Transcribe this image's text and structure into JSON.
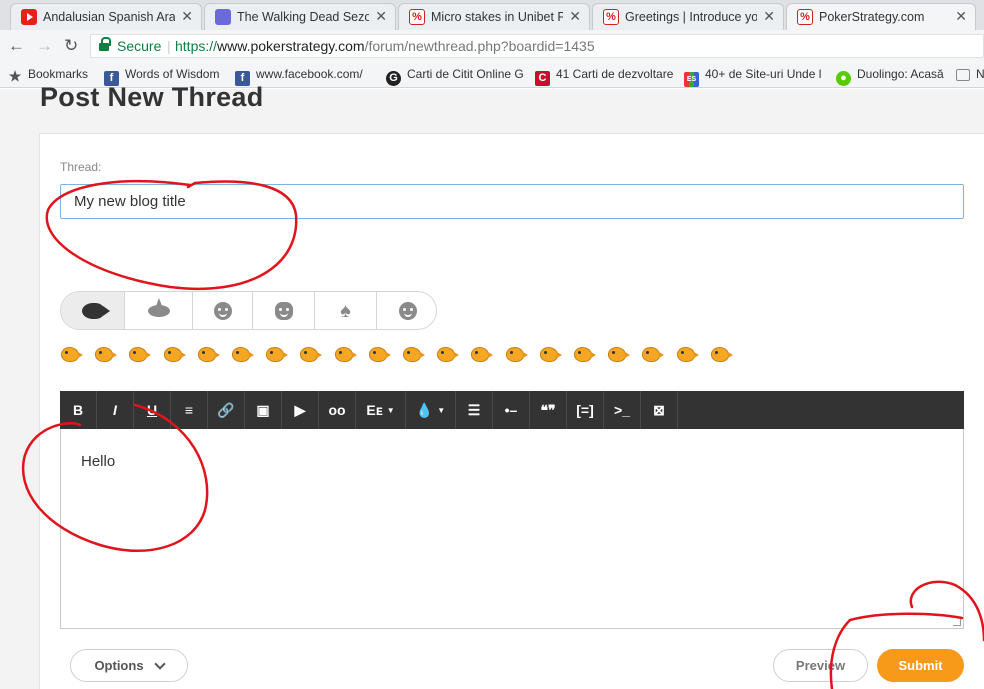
{
  "tabs": [
    {
      "title": "Andalusian Spanish Arab",
      "favicon": "youtube-icon",
      "active": false
    },
    {
      "title": "The Walking Dead Sezon",
      "favicon": "clapperboard-icon",
      "active": false
    },
    {
      "title": "Micro stakes in Unibet Po",
      "favicon": "pokerstrategy-icon",
      "active": false
    },
    {
      "title": "Greetings | Introduce you",
      "favicon": "pokerstrategy-icon",
      "active": false
    },
    {
      "title": "PokerStrategy.com",
      "favicon": "pokerstrategy-icon",
      "active": true
    }
  ],
  "address": {
    "secure_label": "Secure",
    "scheme": "https://",
    "host": "www.pokerstrategy.com",
    "path": "/forum/newthread.php?boardid=1435"
  },
  "bookmarks": [
    {
      "label": "Bookmarks",
      "icon": "star-icon"
    },
    {
      "label": "Words of Wisdom",
      "icon": "facebook-icon"
    },
    {
      "label": "www.facebook.com/",
      "icon": "facebook-icon"
    },
    {
      "label": "Carti de Citit Online G",
      "icon": "g-icon"
    },
    {
      "label": "41 Carti de dezvoltare",
      "icon": "c-icon"
    },
    {
      "label": "40+ de Site-uri Unde l",
      "icon": "site-icon"
    },
    {
      "label": "Duolingo: Acasă",
      "icon": "owl-icon"
    },
    {
      "label": "N",
      "icon": "book-icon"
    }
  ],
  "page": {
    "title": "Post New Thread",
    "thread_label": "Thread:",
    "thread_value": "My new blog title",
    "editor_text": "Hello"
  },
  "emoji_tabs": [
    "fish-icon",
    "shark-icon",
    "smiley-icon",
    "grin-icon",
    "spade-icon",
    "wink-icon"
  ],
  "smiley_count": 20,
  "toolbar": [
    {
      "name": "bold",
      "label": "B"
    },
    {
      "name": "italic",
      "label": "I"
    },
    {
      "name": "underline",
      "label": "U"
    },
    {
      "name": "align-center",
      "label": "≡"
    },
    {
      "name": "link",
      "label": "🔗"
    },
    {
      "name": "image",
      "label": "▣"
    },
    {
      "name": "video",
      "label": "▶"
    },
    {
      "name": "voicemail",
      "label": "oo"
    },
    {
      "name": "font-size",
      "label": "Eᴇ"
    },
    {
      "name": "color",
      "label": "💧"
    },
    {
      "name": "bullet-list",
      "label": "☰"
    },
    {
      "name": "horizontal-rule",
      "label": "•–"
    },
    {
      "name": "quote",
      "label": "❝❞"
    },
    {
      "name": "code-block",
      "label": "[=]"
    },
    {
      "name": "terminal",
      "label": ">_"
    },
    {
      "name": "clear-format",
      "label": "⊠"
    }
  ],
  "buttons": {
    "options": "Options",
    "preview": "Preview",
    "submit": "Submit"
  },
  "colors": {
    "submit": "#f79a1a",
    "toolbar": "#333333",
    "annotation": "#e0141b",
    "input_focus": "#7bb3e4",
    "secure": "#0b8043"
  }
}
